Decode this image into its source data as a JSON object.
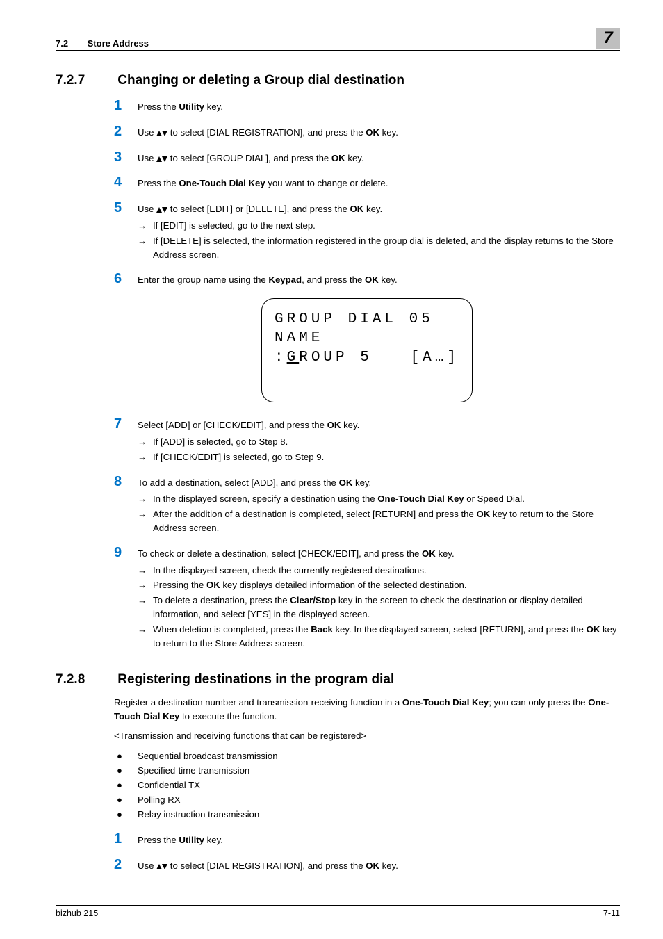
{
  "header": {
    "section_num": "7.2",
    "section_title": "Store Address",
    "chapter_num": "7"
  },
  "section_a": {
    "number": "7.2.7",
    "title": "Changing or deleting a Group dial destination",
    "steps": {
      "s1": {
        "n": "1",
        "pre": "Press the ",
        "b1": "Utility",
        "post": " key."
      },
      "s2": {
        "n": "2",
        "pre": "Use ",
        "mid": " to select [DIAL REGISTRATION], and press the ",
        "b1": "OK",
        "post": " key."
      },
      "s3": {
        "n": "3",
        "pre": "Use ",
        "mid": " to select [GROUP DIAL], and press the ",
        "b1": "OK",
        "post": " key."
      },
      "s4": {
        "n": "4",
        "pre": "Press the ",
        "b1": "One-Touch Dial Key",
        "post": " you want to change or delete."
      },
      "s5": {
        "n": "5",
        "pre": "Use ",
        "mid": " to select [EDIT] or [DELETE], and press the ",
        "b1": "OK",
        "post": " key.",
        "sub1": "If [EDIT] is selected, go to the next step.",
        "sub2": "If [DELETE] is selected, the information registered in the group dial is deleted, and the display returns to the Store Address screen."
      },
      "s6": {
        "n": "6",
        "pre": "Enter the group name using the ",
        "b1": "Keypad",
        "mid": ", and press the ",
        "b2": "OK",
        "post": " key."
      },
      "s7": {
        "n": "7",
        "pre": "Select [ADD] or [CHECK/EDIT], and press the ",
        "b1": "OK",
        "post": " key.",
        "sub1": "If [ADD] is selected, go to Step 8.",
        "sub2": "If [CHECK/EDIT] is selected, go to Step 9."
      },
      "s8": {
        "n": "8",
        "pre": "To add a destination, select [ADD], and press the ",
        "b1": "OK",
        "post": " key.",
        "sub1_pre": "In the displayed screen, specify a destination using the ",
        "sub1_b": "One-Touch Dial Key",
        "sub1_post": " or Speed Dial.",
        "sub2_pre": "After the addition of a destination is completed, select [RETURN] and press the ",
        "sub2_b": "OK",
        "sub2_post": " key to return to the Store Address screen."
      },
      "s9": {
        "n": "9",
        "pre": "To check or delete a destination, select [CHECK/EDIT], and press the ",
        "b1": "OK",
        "post": " key.",
        "sub1": "In the displayed screen, check the currently registered destinations.",
        "sub2_pre": "Pressing the ",
        "sub2_b": "OK",
        "sub2_post": " key displays detailed information of the selected destination.",
        "sub3_pre": "To delete a destination, press the ",
        "sub3_b": "Clear/Stop",
        "sub3_post": " key in the screen to check the destination or display detailed information, and select [YES] in the displayed screen.",
        "sub4_pre": "When deletion is completed, press the ",
        "sub4_b": "Back",
        "sub4_mid": " key. In the displayed screen, select [RETURN], and press the ",
        "sub4_b2": "OK",
        "sub4_post": " key to return to the Store Address screen."
      }
    }
  },
  "lcd": {
    "line1": "GROUP DIAL 05",
    "line2": "NAME",
    "line3_prefix": ":",
    "line3_cursor": "G",
    "line3_rest": "ROUP 5",
    "line3_right": "[A…]"
  },
  "section_b": {
    "number": "7.2.8",
    "title": "Registering destinations in the program dial",
    "intro_pre": "Register a destination number and transmission-receiving function in a ",
    "intro_b1": "One-Touch Dial Key",
    "intro_mid": "; you can only press the ",
    "intro_b2": "One-Touch Dial Key",
    "intro_post": " to execute the function.",
    "list_caption": "<Transmission and receiving functions that can be registered>",
    "bullets": [
      "Sequential broadcast transmission",
      "Specified-time transmission",
      "Confidential TX",
      "Polling RX",
      "Relay instruction transmission"
    ],
    "steps": {
      "s1": {
        "n": "1",
        "pre": "Press the ",
        "b1": "Utility",
        "post": " key."
      },
      "s2": {
        "n": "2",
        "pre": "Use ",
        "mid": " to select [DIAL REGISTRATION], and press the ",
        "b1": "OK",
        "post": " key."
      }
    }
  },
  "footer": {
    "left": "bizhub 215",
    "right": "7-11"
  }
}
